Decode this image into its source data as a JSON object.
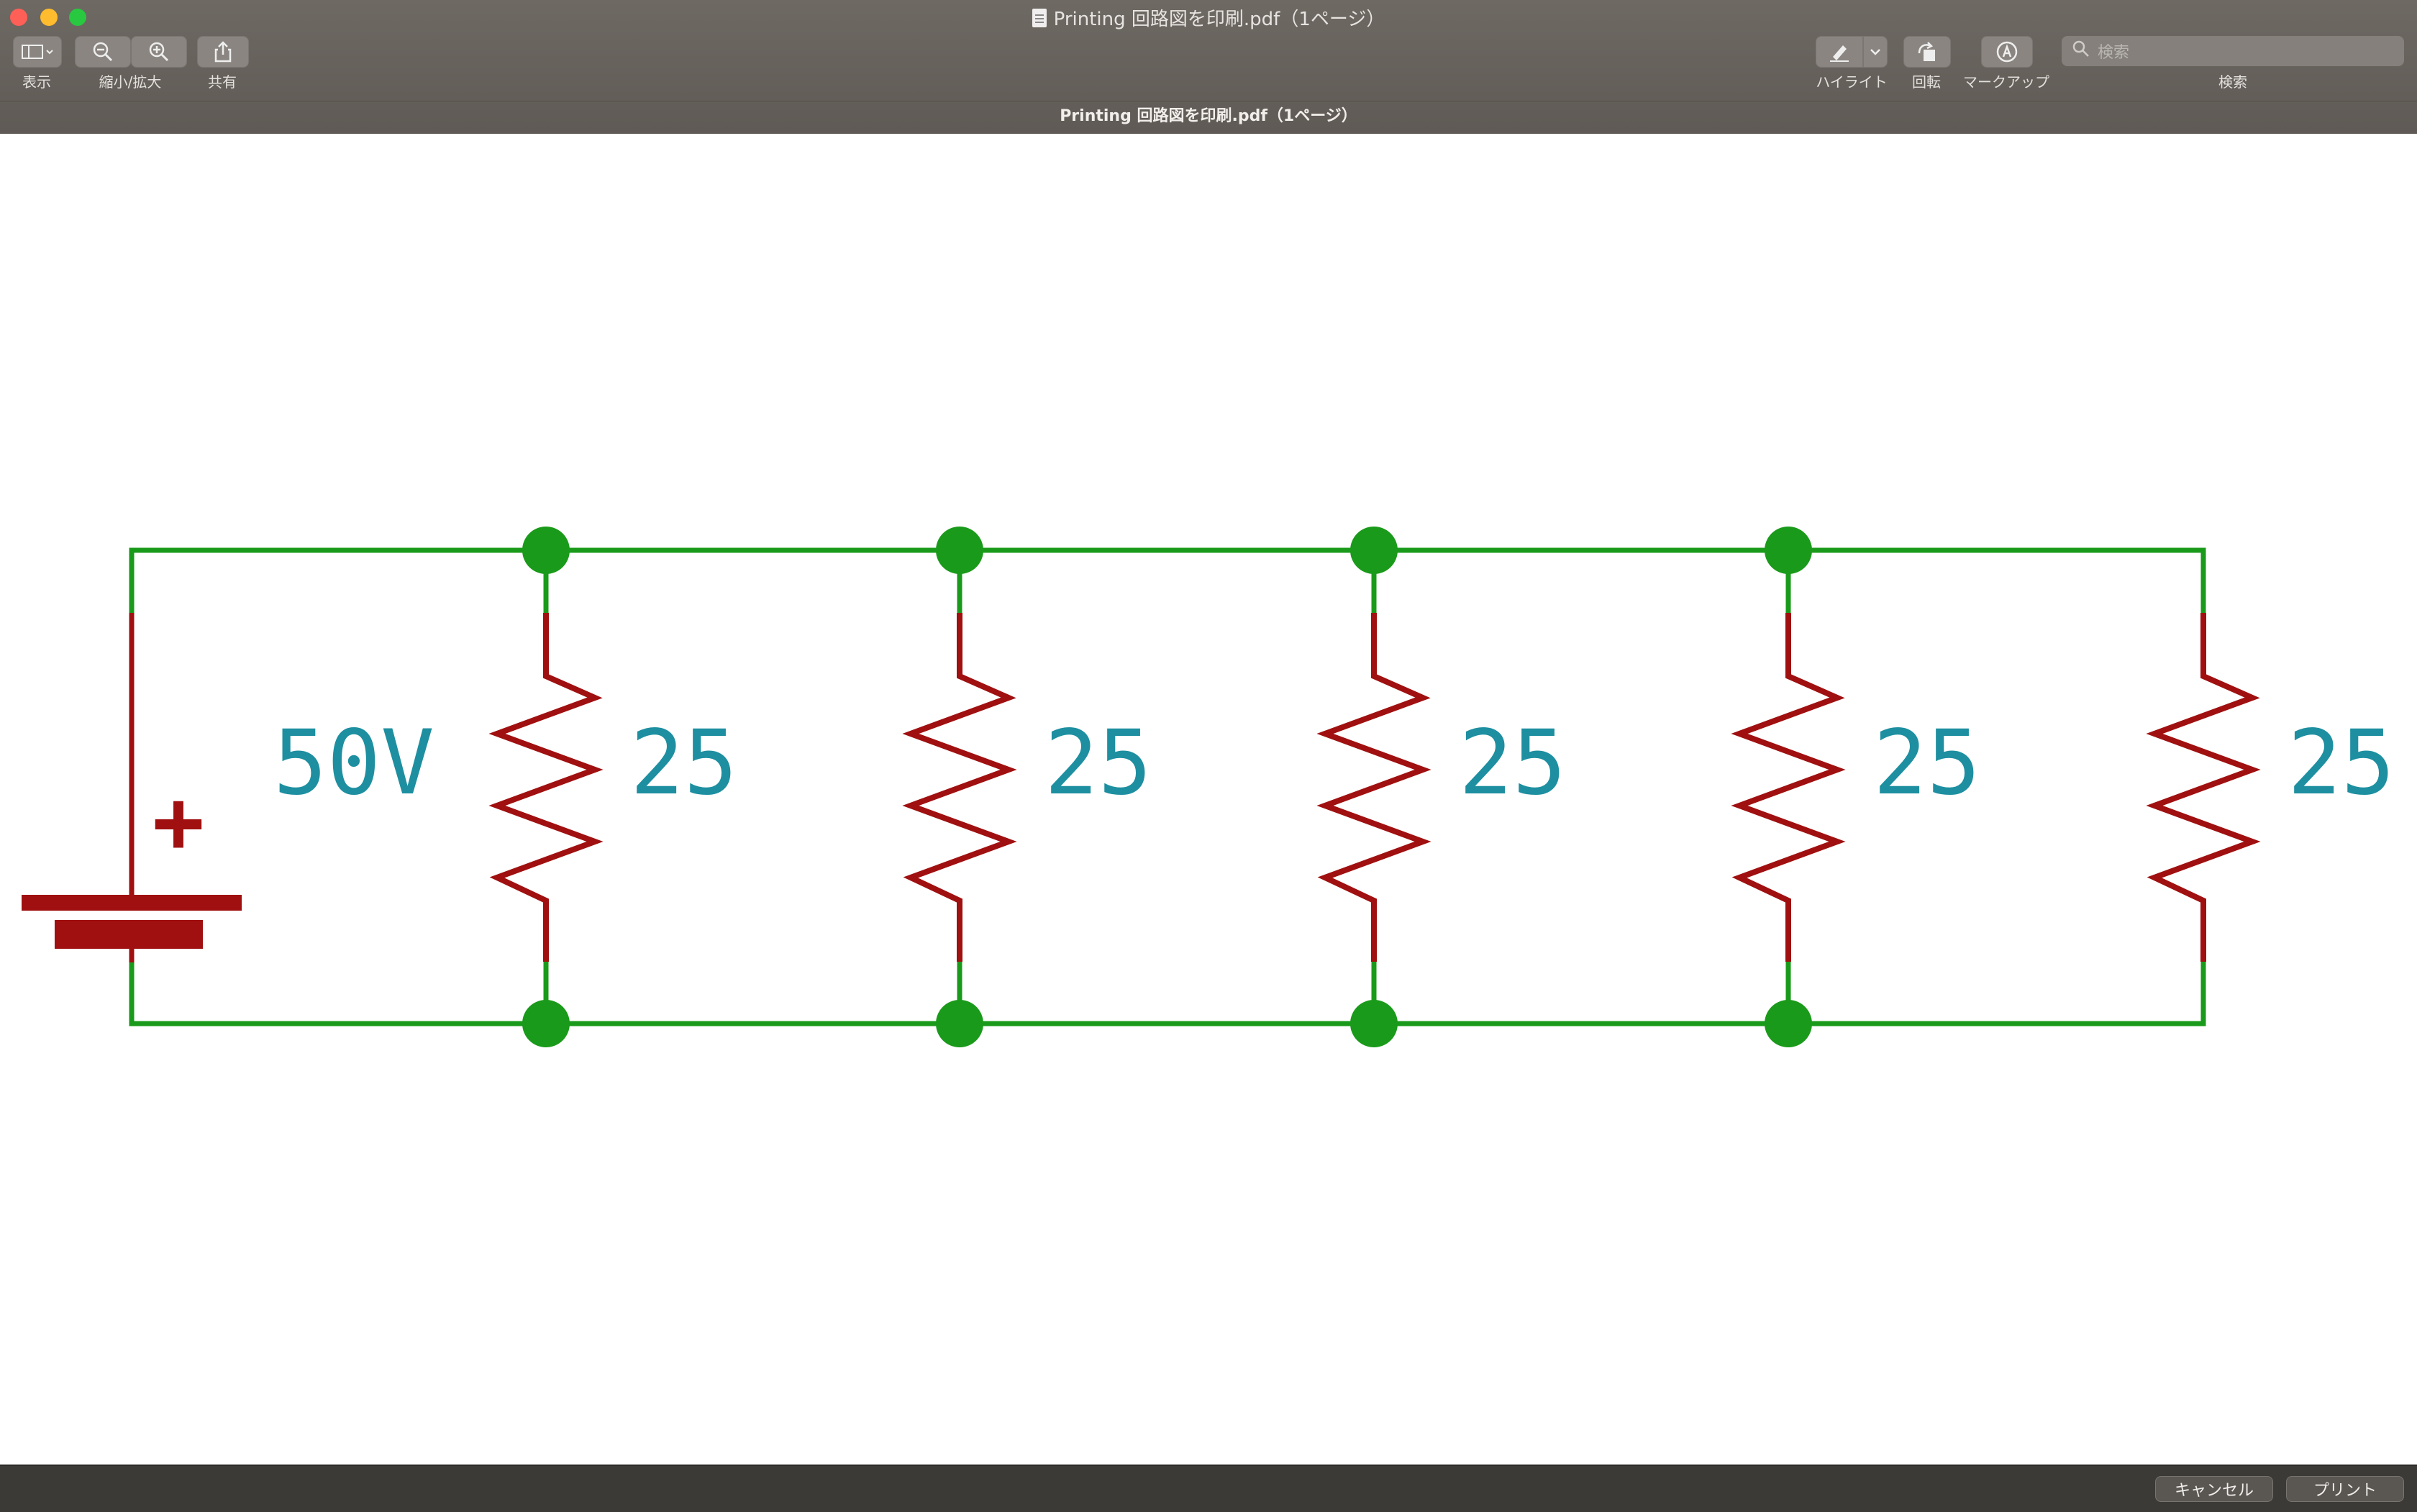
{
  "window": {
    "title": "Printing 回路図を印刷.pdf（1ページ）",
    "subtitle": "Printing 回路図を印刷.pdf（1ページ）"
  },
  "toolbar": {
    "view_label": "表示",
    "zoom_label": "縮小/拡大",
    "share_label": "共有",
    "highlight_label": "ハイライト",
    "rotate_label": "回転",
    "markup_label": "マークアップ",
    "search_label": "検索",
    "search_placeholder": "検索"
  },
  "circuit": {
    "battery_label": "50V",
    "plus_sign": "+",
    "resistors": [
      "25",
      "25",
      "25",
      "25",
      "25"
    ],
    "colors": {
      "wire": "#1a9a1a",
      "component": "#a01010",
      "label": "#1d8fa0"
    }
  },
  "footer": {
    "cancel_label": "キャンセル",
    "print_label": "プリント"
  }
}
